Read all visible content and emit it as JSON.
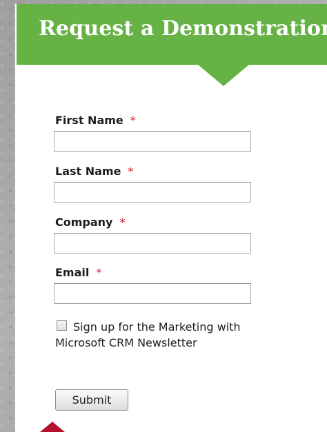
{
  "header": {
    "title": "Request a Demonstration"
  },
  "form": {
    "fields": [
      {
        "label": "First Name",
        "required_mark": "*",
        "value": ""
      },
      {
        "label": "Last Name",
        "required_mark": "*",
        "value": ""
      },
      {
        "label": "Company",
        "required_mark": "*",
        "value": ""
      },
      {
        "label": "Email",
        "required_mark": "*",
        "value": ""
      }
    ],
    "newsletter": {
      "label": "Sign up for the Marketing with Microsoft CRM Newsletter",
      "checked": false
    },
    "submit_label": "Submit"
  },
  "colors": {
    "header_green": "#66b244",
    "required_red": "#d01f2f",
    "pointer_red": "#b5112f"
  }
}
